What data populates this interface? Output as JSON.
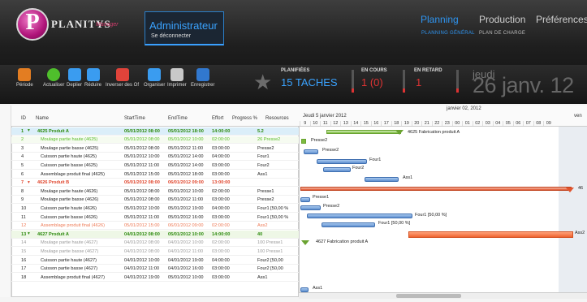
{
  "header": {
    "logo_text": "PLANITYS",
    "logo_sub": "Manager",
    "admin_title": "Administrateur",
    "admin_sub": "Se déconnecter",
    "nav": [
      {
        "label": "Planning",
        "sub": "PLANNING GÉNÉRAL"
      },
      {
        "label": "Production",
        "sub": "PLAN DE CHARGE"
      },
      {
        "label": "Préférences",
        "sub": ""
      }
    ]
  },
  "toolbar": {
    "buttons": [
      "Période",
      "Actualiser",
      "Deplier",
      "Réduire",
      "Inverser des Of",
      "Organiser",
      "Imprimer",
      "Enregistrer"
    ],
    "stats": {
      "planified_label": "PLANIFIÉES",
      "planified_value": "15 TACHES",
      "encours_label": "EN COURS",
      "encours_value": "1 (0)",
      "retard_label": "EN RETARD",
      "retard_value": "1"
    },
    "date_day": "jeudi",
    "date_big": "26 janv. 12"
  },
  "grid": {
    "headers": [
      "ID",
      "Name",
      "StartTime",
      "EndTime",
      "Effort",
      "Progress %",
      "Resources"
    ],
    "rows": [
      {
        "id": "1",
        "name": "4625 Produit A",
        "start": "05/01/2012 08:00",
        "end": "05/01/2012 18:00",
        "effort": "14:00:00",
        "prog": "",
        "res": "5.2",
        "cls": "group sel"
      },
      {
        "id": "2",
        "name": "Moulage partie haute (4625)",
        "start": "05/01/2012 08:00",
        "end": "05/01/2012 10:00",
        "effort": "02:00:00",
        "prog": "",
        "res": "26 Presse2",
        "cls": "green"
      },
      {
        "id": "3",
        "name": "Moulage partie basse (4625)",
        "start": "05/01/2012 08:00",
        "end": "05/01/2012 11:00",
        "effort": "03:00:00",
        "prog": "",
        "res": "Presse2",
        "cls": ""
      },
      {
        "id": "4",
        "name": "Cuisson partie haute (4625)",
        "start": "05/01/2012 10:00",
        "end": "05/01/2012 14:00",
        "effort": "04:00:00",
        "prog": "",
        "res": "Four1",
        "cls": ""
      },
      {
        "id": "5",
        "name": "Cuisson partie basse (4625)",
        "start": "05/01/2012 11:00",
        "end": "05/01/2012 14:00",
        "effort": "03:00:00",
        "prog": "",
        "res": "Four2",
        "cls": ""
      },
      {
        "id": "6",
        "name": "Assemblage produit final (4625)",
        "start": "05/01/2012 15:00",
        "end": "05/01/2012 18:00",
        "effort": "03:00:00",
        "prog": "",
        "res": "Ass1",
        "cls": ""
      },
      {
        "id": "7",
        "name": "4626 Produit B",
        "start": "05/01/2012 08:00",
        "end": "06/01/2012 09:00",
        "effort": "13:00:00",
        "prog": "",
        "res": "",
        "cls": "group-red"
      },
      {
        "id": "8",
        "name": "Moulage partie haute (4626)",
        "start": "05/01/2012 08:00",
        "end": "05/01/2012 10:00",
        "effort": "02:00:00",
        "prog": "",
        "res": "Presse1",
        "cls": ""
      },
      {
        "id": "9",
        "name": "Moulage partie basse (4626)",
        "start": "05/01/2012 08:00",
        "end": "05/01/2012 11:00",
        "effort": "03:00:00",
        "prog": "",
        "res": "Presse2",
        "cls": ""
      },
      {
        "id": "10",
        "name": "Cuisson partie haute (4626)",
        "start": "05/01/2012 10:00",
        "end": "05/01/2012 19:00",
        "effort": "04:00:00",
        "prog": "",
        "res": "Four1 [50,00 %",
        "cls": ""
      },
      {
        "id": "11",
        "name": "Cuisson partie basse (4626)",
        "start": "05/01/2012 11:00",
        "end": "05/01/2012 16:00",
        "effort": "03:00:00",
        "prog": "",
        "res": "Four1 [50,00 %",
        "cls": ""
      },
      {
        "id": "12",
        "name": "Assemblage produit final (4626)",
        "start": "05/01/2012 15:00",
        "end": "06/01/2012 09:00",
        "effort": "02:00:00",
        "prog": "",
        "res": "Ass2",
        "cls": "red"
      },
      {
        "id": "13",
        "name": "4627 Produit A",
        "start": "04/01/2012 08:00",
        "end": "05/01/2012 10:00",
        "effort": "14:00:00",
        "prog": "",
        "res": "40",
        "cls": "group"
      },
      {
        "id": "14",
        "name": "Moulage partie haute (4627)",
        "start": "04/01/2012 08:00",
        "end": "04/01/2012 10:00",
        "effort": "02:00:00",
        "prog": "",
        "res": "100 Presse1",
        "cls": "grey"
      },
      {
        "id": "15",
        "name": "Moulage partie basse (4627)",
        "start": "04/01/2012 08:00",
        "end": "04/01/2012 11:00",
        "effort": "03:00:00",
        "prog": "",
        "res": "100 Presse1",
        "cls": "grey"
      },
      {
        "id": "16",
        "name": "Cuisson partie haute (4627)",
        "start": "04/01/2012 10:00",
        "end": "04/01/2012 19:00",
        "effort": "04:00:00",
        "prog": "",
        "res": "Four2 [50,00",
        "cls": ""
      },
      {
        "id": "17",
        "name": "Cuisson partie basse (4627)",
        "start": "04/01/2012 11:00",
        "end": "04/01/2012 16:00",
        "effort": "03:00:00",
        "prog": "",
        "res": "Four2 [50,00",
        "cls": ""
      },
      {
        "id": "18",
        "name": "Assemblage produit final (4627)",
        "start": "04/01/2012 19:00",
        "end": "05/01/2012 10:00",
        "effort": "03:00:00",
        "prog": "",
        "res": "Ass1",
        "cls": ""
      }
    ]
  },
  "gantt": {
    "month": "janvier 02, 2012",
    "week": "Jeudi 5 janvier 2012",
    "right_label": "ven",
    "days": [
      "9",
      "10",
      "11",
      "12",
      "13",
      "14",
      "15",
      "16",
      "17",
      "18",
      "19",
      "20",
      "21",
      "22",
      "23",
      "00",
      "01",
      "02",
      "03",
      "04",
      "05",
      "06",
      "07",
      "08",
      "09"
    ],
    "labels": {
      "p4625": "4625 Fabrication produit A",
      "presse2a": "Presse2",
      "presse2b": "Presse2",
      "four1": "Four1",
      "four2": "Four2",
      "ass1": "Ass1",
      "p4626": "46",
      "presse1": "Presse1",
      "presse2c": "Presse2",
      "four1_50": "Four1 [50,00 %]",
      "four1_50b": "Four1 [50,00 %]",
      "ass2": "Ass2",
      "p4627": "4627 Fabrication produit A",
      "ass1b": "Ass1"
    }
  }
}
